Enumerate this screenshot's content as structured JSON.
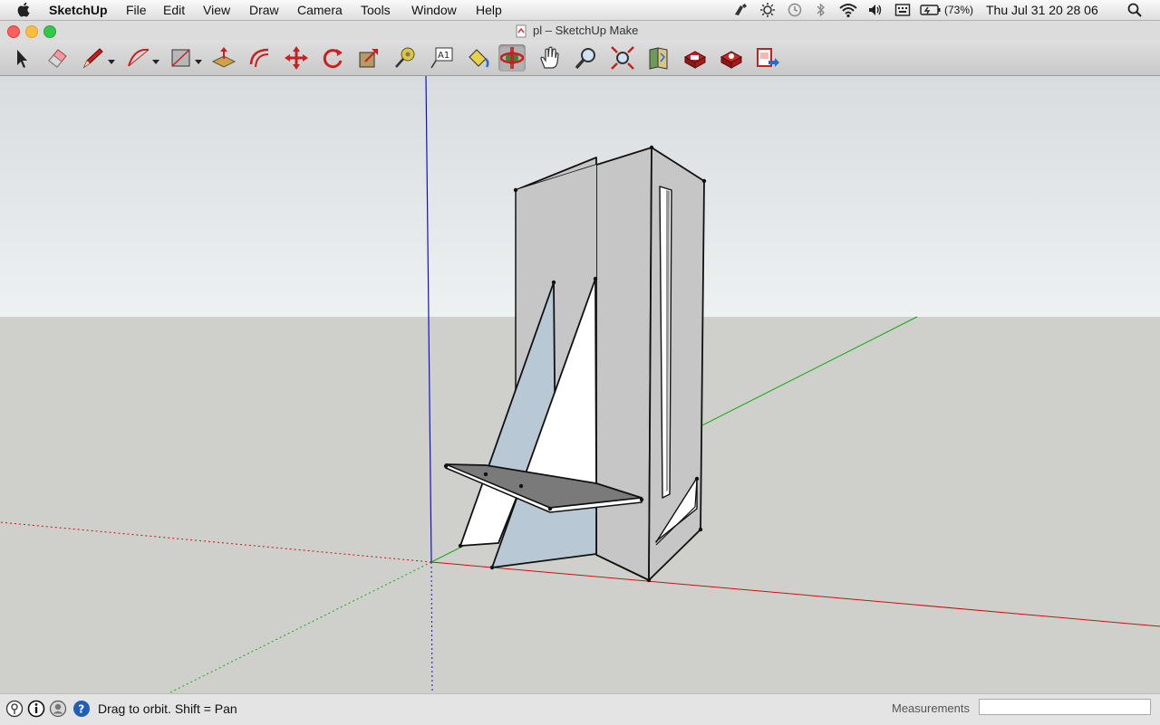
{
  "menubar": {
    "app_name": "SketchUp",
    "items": [
      "File",
      "Edit",
      "View",
      "Draw",
      "Camera",
      "Tools",
      "Window",
      "Help"
    ],
    "status_icons": [
      "ink-icon",
      "brightness-icon",
      "time-machine-icon",
      "bluetooth-icon",
      "wifi-icon",
      "volume-icon",
      "keyboard-icon",
      "battery-icon"
    ],
    "battery_percent": "(73%)",
    "clock": "Thu Jul 31  20 28 06"
  },
  "window": {
    "title": "pl – SketchUp Make"
  },
  "toolbar": {
    "tools": [
      "select-tool",
      "eraser-tool",
      "line-tool",
      "arc-tool",
      "shape-tool",
      "push-pull-tool",
      "offset-tool",
      "move-tool",
      "rotate-tool",
      "scale-tool",
      "tape-measure-tool",
      "text-tool",
      "paint-bucket-tool",
      "orbit-tool",
      "pan-tool",
      "zoom-tool",
      "zoom-extents-tool",
      "get-models-tool",
      "share-model-tool",
      "extension-warehouse-tool",
      "send-to-layout-tool"
    ],
    "active_tool": "orbit-tool"
  },
  "colors": {
    "sky_top": "#d8dcde",
    "sky_bottom": "#eef1f2",
    "ground": "#cfcfcb",
    "axis_red": "#cc1111",
    "axis_green": "#11aa11",
    "axis_blue": "#1111cc",
    "face_front": "#c6c6c6",
    "face_back": "#b8c8d4",
    "face_white": "#ffffff",
    "face_dark": "#7a7a7a"
  },
  "statusbar": {
    "hint": "Drag to orbit.  Shift = Pan",
    "measurements_label": "Measurements",
    "measurements_value": ""
  }
}
